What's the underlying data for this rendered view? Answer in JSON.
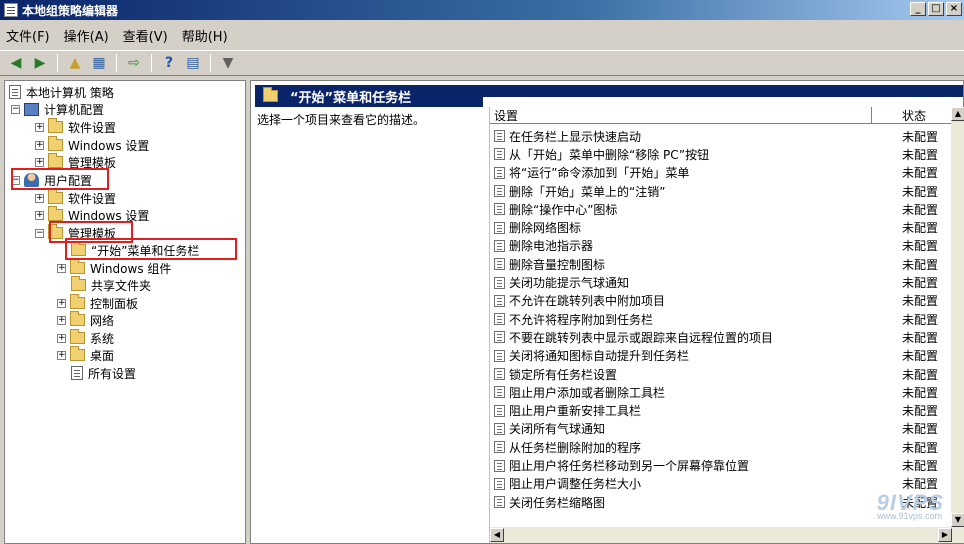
{
  "window": {
    "title": "本地组策略编辑器",
    "btn_min": "_",
    "btn_max": "□",
    "btn_close": "×"
  },
  "menu": [
    "文件(F)",
    "操作(A)",
    "查看(V)",
    "帮助(H)"
  ],
  "tree": {
    "root": "本地计算机 策略",
    "computer_config": "计算机配置",
    "cc_software": "软件设置",
    "cc_windows": "Windows 设置",
    "cc_admin": "管理模板",
    "user_config": "用户配置",
    "uc_software": "软件设置",
    "uc_windows": "Windows 设置",
    "uc_admin": "管理模板",
    "start_menu": "“开始”菜单和任务栏",
    "win_components": "Windows 组件",
    "shared_folders": "共享文件夹",
    "control_panel": "控制面板",
    "network": "网络",
    "system": "系统",
    "desktop": "桌面",
    "all_settings": "所有设置"
  },
  "right": {
    "header": "“开始”菜单和任务栏",
    "description": "选择一个项目来查看它的描述。",
    "col_setting": "设置",
    "col_state": "状态"
  },
  "settings": [
    {
      "name": "在任务栏上显示快速启动",
      "state": "未配置"
    },
    {
      "name": "从「开始」菜单中删除“移除 PC”按钮",
      "state": "未配置"
    },
    {
      "name": "将“运行”命令添加到「开始」菜单",
      "state": "未配置"
    },
    {
      "name": "删除「开始」菜单上的“注销”",
      "state": "未配置"
    },
    {
      "name": "删除“操作中心”图标",
      "state": "未配置"
    },
    {
      "name": "删除网络图标",
      "state": "未配置"
    },
    {
      "name": "删除电池指示器",
      "state": "未配置"
    },
    {
      "name": "删除音量控制图标",
      "state": "未配置"
    },
    {
      "name": "关闭功能提示气球通知",
      "state": "未配置"
    },
    {
      "name": "不允许在跳转列表中附加项目",
      "state": "未配置"
    },
    {
      "name": "不允许将程序附加到任务栏",
      "state": "未配置"
    },
    {
      "name": "不要在跳转列表中显示或跟踪来自远程位置的项目",
      "state": "未配置"
    },
    {
      "name": "关闭将通知图标自动提升到任务栏",
      "state": "未配置"
    },
    {
      "name": "锁定所有任务栏设置",
      "state": "未配置"
    },
    {
      "name": "阻止用户添加或者删除工具栏",
      "state": "未配置"
    },
    {
      "name": "阻止用户重新安排工具栏",
      "state": "未配置"
    },
    {
      "name": "关闭所有气球通知",
      "state": "未配置"
    },
    {
      "name": "从任务栏删除附加的程序",
      "state": "未配置"
    },
    {
      "name": "阻止用户将任务栏移动到另一个屏幕停靠位置",
      "state": "未配置"
    },
    {
      "name": "阻止用户调整任务栏大小",
      "state": "未配置"
    },
    {
      "name": "关闭任务栏缩略图",
      "state": "未配置"
    }
  ],
  "watermark": {
    "main": "9IVPS",
    "sub": "www.91vps.com"
  }
}
